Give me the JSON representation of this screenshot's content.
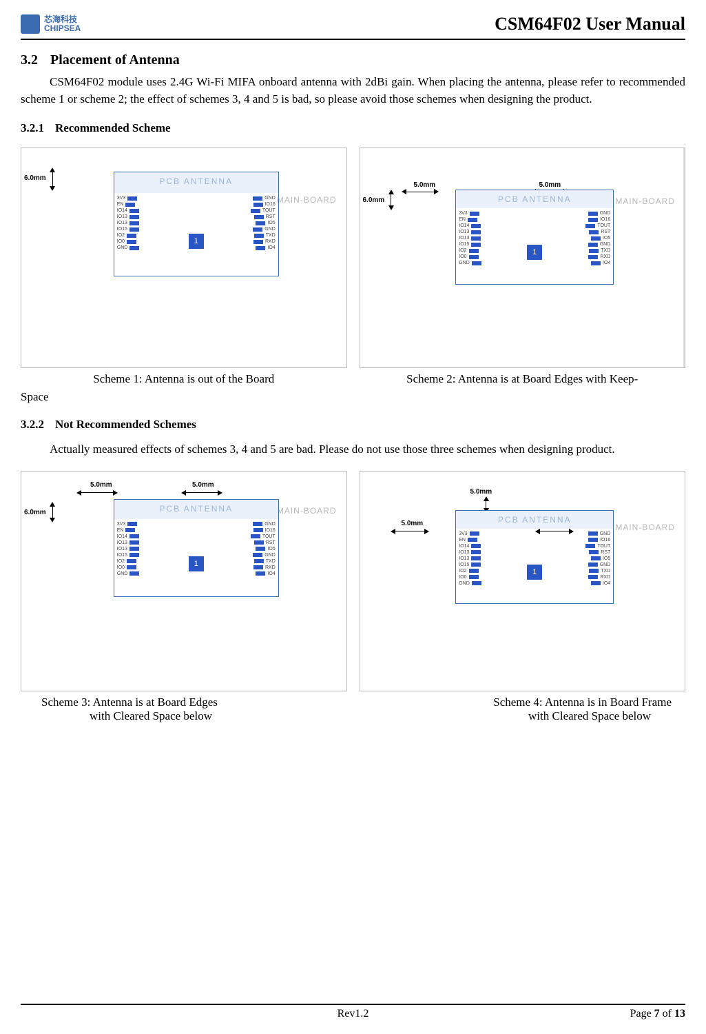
{
  "header": {
    "logo_line1": "芯海科技",
    "logo_line2": "CHIPSEA",
    "doc_title": "CSM64F02 User Manual"
  },
  "section": {
    "num": "3.2",
    "title": "Placement of Antenna",
    "para": "CSM64F02 module uses 2.4G Wi-Fi MIFA onboard antenna with 2dBi gain. When placing the antenna, please refer to recommended scheme 1 or scheme 2; the effect of schemes 3, 4 and 5 is bad, so please avoid those schemes when designing the product."
  },
  "sub1": {
    "num": "3.2.1",
    "title": "Recommended Scheme",
    "fig1_caption": "Scheme 1: Antenna is out of the Board",
    "fig2_caption": "Scheme 2: Antenna is at Board Edges with Keep-",
    "trail": "Space"
  },
  "sub2": {
    "num": "3.2.2",
    "title": "Not Recommended Schemes",
    "para": "Actually measured effects of schemes 3, 4 and 5 are bad. Please do not use those three schemes when designing product.",
    "fig3_caption_l1": "Scheme 3: Antenna is at Board Edges",
    "fig3_caption_l2": "with Cleared Space below",
    "fig4_caption_l1": "Scheme 4: Antenna is in Board Frame",
    "fig4_caption_l2": "with Cleared Space below"
  },
  "fig_common": {
    "pcb_antenna_label": "PCB ANTENNA",
    "main_board_label": "MAIN-BOARD",
    "chip_label": "1",
    "dim_6mm": "6.0mm",
    "dim_5mm": "5.0mm",
    "pins_left": [
      "3V3",
      "EN",
      "IO14",
      "IO13",
      "IO13",
      "IO15",
      "IO2",
      "IO0",
      "GND"
    ],
    "pins_right": [
      "GND",
      "IO16",
      "TOUT",
      "RST",
      "IO5",
      "GND",
      "TXD",
      "RXD",
      "IO4"
    ]
  },
  "footer": {
    "rev": "Rev1.2",
    "page_prefix": "Page ",
    "page_num": "7",
    "page_of": " of ",
    "page_total": "13"
  }
}
